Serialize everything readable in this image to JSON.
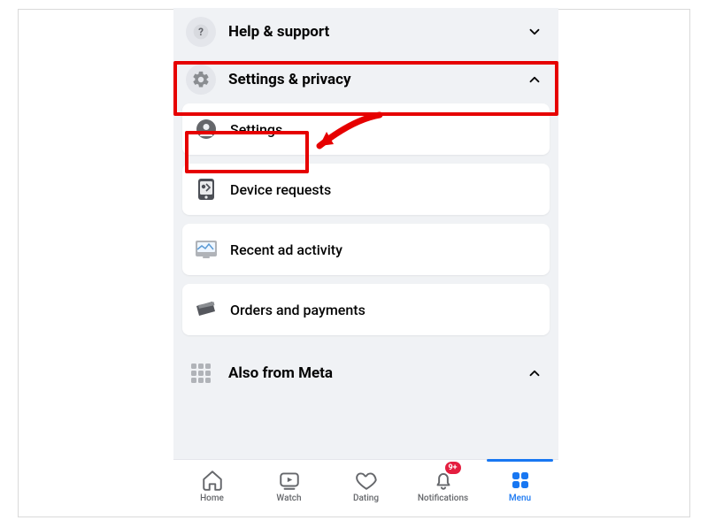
{
  "sections": {
    "help": {
      "label": "Help & support"
    },
    "settings_privacy": {
      "label": "Settings & privacy"
    },
    "also_meta": {
      "label": "Also from Meta"
    }
  },
  "settings_privacy_items": {
    "settings": {
      "label": "Settings"
    },
    "device_requests": {
      "label": "Device requests"
    },
    "recent_ad": {
      "label": "Recent ad activity"
    },
    "orders": {
      "label": "Orders and payments"
    }
  },
  "tabs": {
    "home": {
      "label": "Home"
    },
    "watch": {
      "label": "Watch"
    },
    "dating": {
      "label": "Dating"
    },
    "notifications": {
      "label": "Notifications",
      "badge": "9+"
    },
    "menu": {
      "label": "Menu"
    }
  },
  "colors": {
    "accent": "#1877f2",
    "annotation": "#e60000",
    "badge": "#e41e3f"
  }
}
